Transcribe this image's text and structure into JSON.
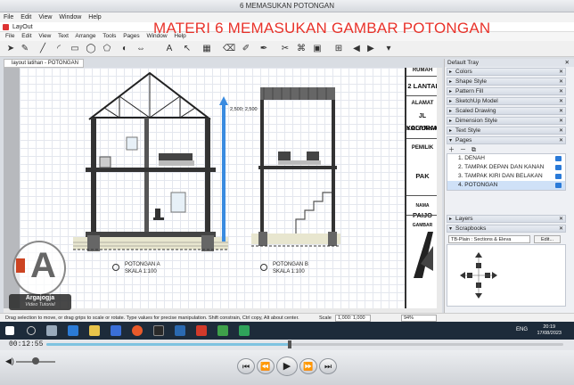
{
  "player": {
    "title": "6 MEMASUKAN POTONGAN",
    "menu": [
      "File",
      "Edit",
      "View",
      "Window",
      "Help"
    ],
    "timecode": "00:12:55",
    "progress": 0.47
  },
  "layout_app": {
    "title": "LayOut",
    "menu": [
      "File",
      "Edit",
      "View",
      "Text",
      "Arrange",
      "Tools",
      "Pages",
      "Window",
      "Help"
    ],
    "doc_tab": "layout latihan - POTONGAN"
  },
  "overlay_heading": "MATERI 6  MEMASUKAN GAMBAR POTONGAN",
  "drawing": {
    "dim_label": "2,500; 2,500",
    "section_a": {
      "title": "POTONGAN A",
      "scale": "SKALA 1:100"
    },
    "section_b": {
      "title": "POTONGAN B",
      "scale": "SKALA 1:100"
    }
  },
  "title_block": {
    "cells": [
      "RUMAH",
      "2 LANTAI",
      "ALAMAT",
      "JL KALIURANG",
      "YOGYAKARTA",
      "PEMILIK",
      "PAK PAIJO",
      "NAMA GAMBAR"
    ]
  },
  "status": {
    "hint": "Drag selection to move, or drag grips to scale or rotate. Type values for precise manipulation. Shift constrain, Ctrl copy, Alt about center.",
    "scale_label": "Scale",
    "scale_value": "1,000: 1,000",
    "zoom": "94%"
  },
  "tray": {
    "title": "Default Tray",
    "panels_top": [
      "Colors",
      "Shape Style",
      "Pattern Fill",
      "SketchUp Model",
      "Scaled Drawing",
      "Dimension Style",
      "Text Style"
    ],
    "pages_label": "Pages",
    "pages": [
      {
        "num": "1.",
        "name": "DENAH"
      },
      {
        "num": "2.",
        "name": "TAMPAK DEPAN DAN KANAN"
      },
      {
        "num": "3.",
        "name": "TAMPAK KIRI DAN BELAKAN"
      },
      {
        "num": "4.",
        "name": "POTONGAN"
      }
    ],
    "layers_label": "Layers",
    "scrapbooks_label": "Scrapbooks",
    "scrapbook_select": "TB-Plain : Sections & Eleva",
    "scrapbook_edit": "Edit..."
  },
  "logo": {
    "line1": "Argajogja",
    "line2": "Video Tutorial"
  },
  "taskbar": {
    "lang": "ENG",
    "time": "20:19",
    "date": "17/08/2023"
  }
}
